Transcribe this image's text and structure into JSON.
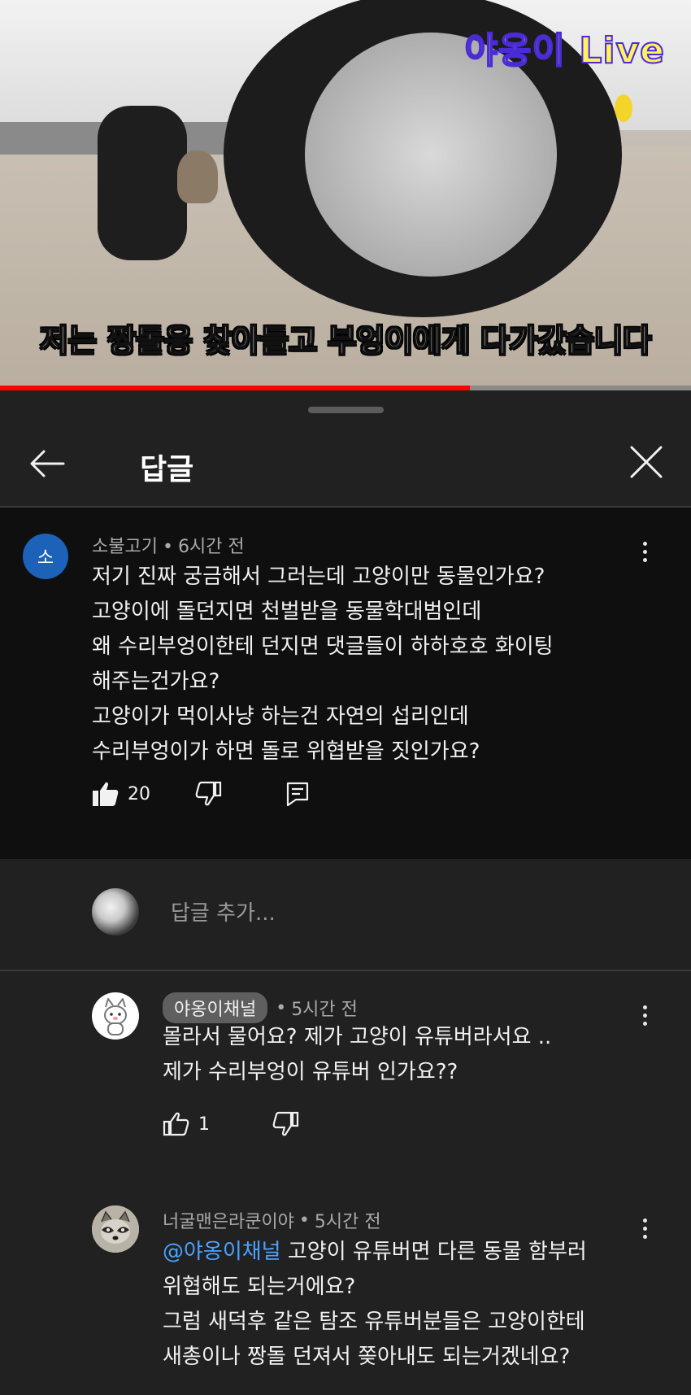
{
  "video": {
    "channel_name": "야옹이",
    "live_label": "Live",
    "subtitle": "저는 짱돌응 찾아들고 부엉이에게 다가갔습니다",
    "progress": 0.68
  },
  "panel": {
    "title": "답글",
    "back_icon": "arrow-left-icon",
    "close_icon": "close-icon"
  },
  "comment": {
    "avatar_letter": "소",
    "author": "소불고기",
    "separator": "•",
    "time": "6시간 전",
    "text": "저기 진짜 궁금해서 그러는데 고양이만 동물인가요?\n고양이에 돌던지면 천벌받을 동물학대범인데\n왜 수리부엉이한테 던지면 댓글들이 하하호호 화이팅\n해주는건가요?\n고양이가 먹이사냥 하는건 자연의 섭리인데\n수리부엉이가 하면 돌로 위협받을 짓인가요?",
    "likes": "20"
  },
  "reply_input": {
    "placeholder": "답글 추가..."
  },
  "replies": [
    {
      "author": "야옹이채널",
      "separator": "•",
      "time": "5시간 전",
      "text": "몰라서 물어요?  제가 고양이 유튜버라서요  ..\n제가 수리부엉이 유튜버 인가요??",
      "likes": "1"
    },
    {
      "author": "너굴맨은라쿤이야",
      "separator": "•",
      "time": "5시간 전",
      "mention": "@야옹이채널",
      "text_first": "  고양이 유튜버면 다른 동물 함부러",
      "text_rest": "위협해도 되는거에요?\n그럼 새덕후 같은 탐조 유튜버분들은 고양이한테\n새총이나 짱돌 던져서 쫒아내도 되는거겠네요?"
    }
  ],
  "colors": {
    "background": "#212121",
    "highlight_comment": "#0f0f0f",
    "progress_red": "#ff0000",
    "mention_blue": "#4aa3ff",
    "avatar_blue": "#1c62b9"
  }
}
